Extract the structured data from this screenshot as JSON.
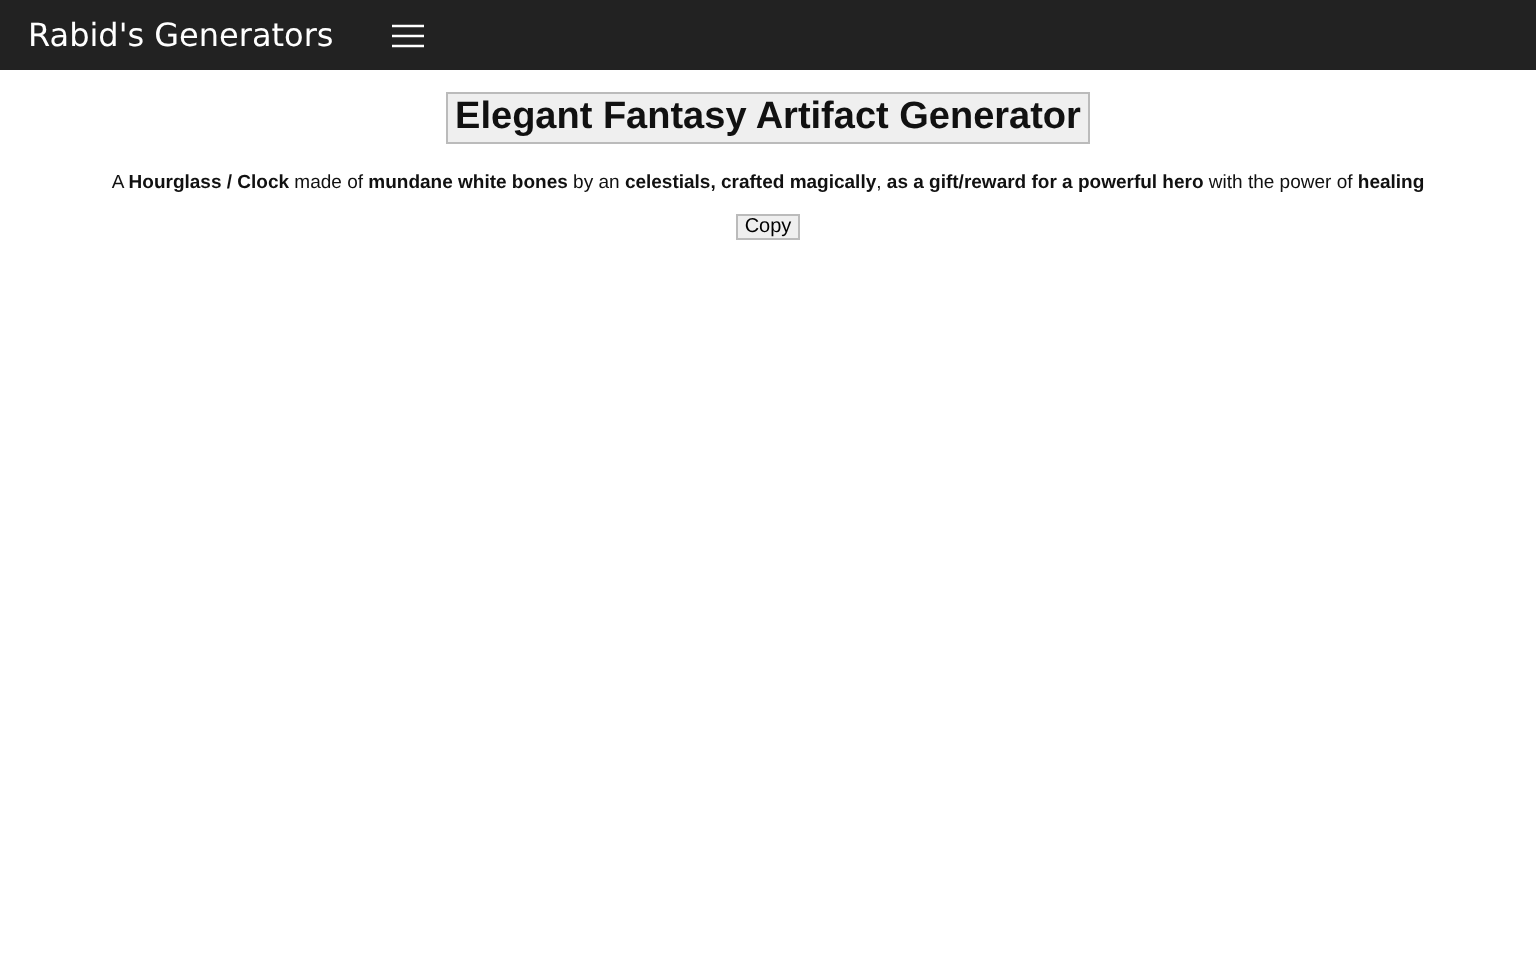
{
  "navbar": {
    "brand": "Rabid's Generators"
  },
  "generate_button": "Elegant Fantasy Artifact Generator",
  "result": "A **Hourglass / Clock** made of **mundane white bones** by an **celestials, crafted magically**, **as a gift/reward for a powerful hero** with the power of **healing**",
  "copy_button": "Copy"
}
